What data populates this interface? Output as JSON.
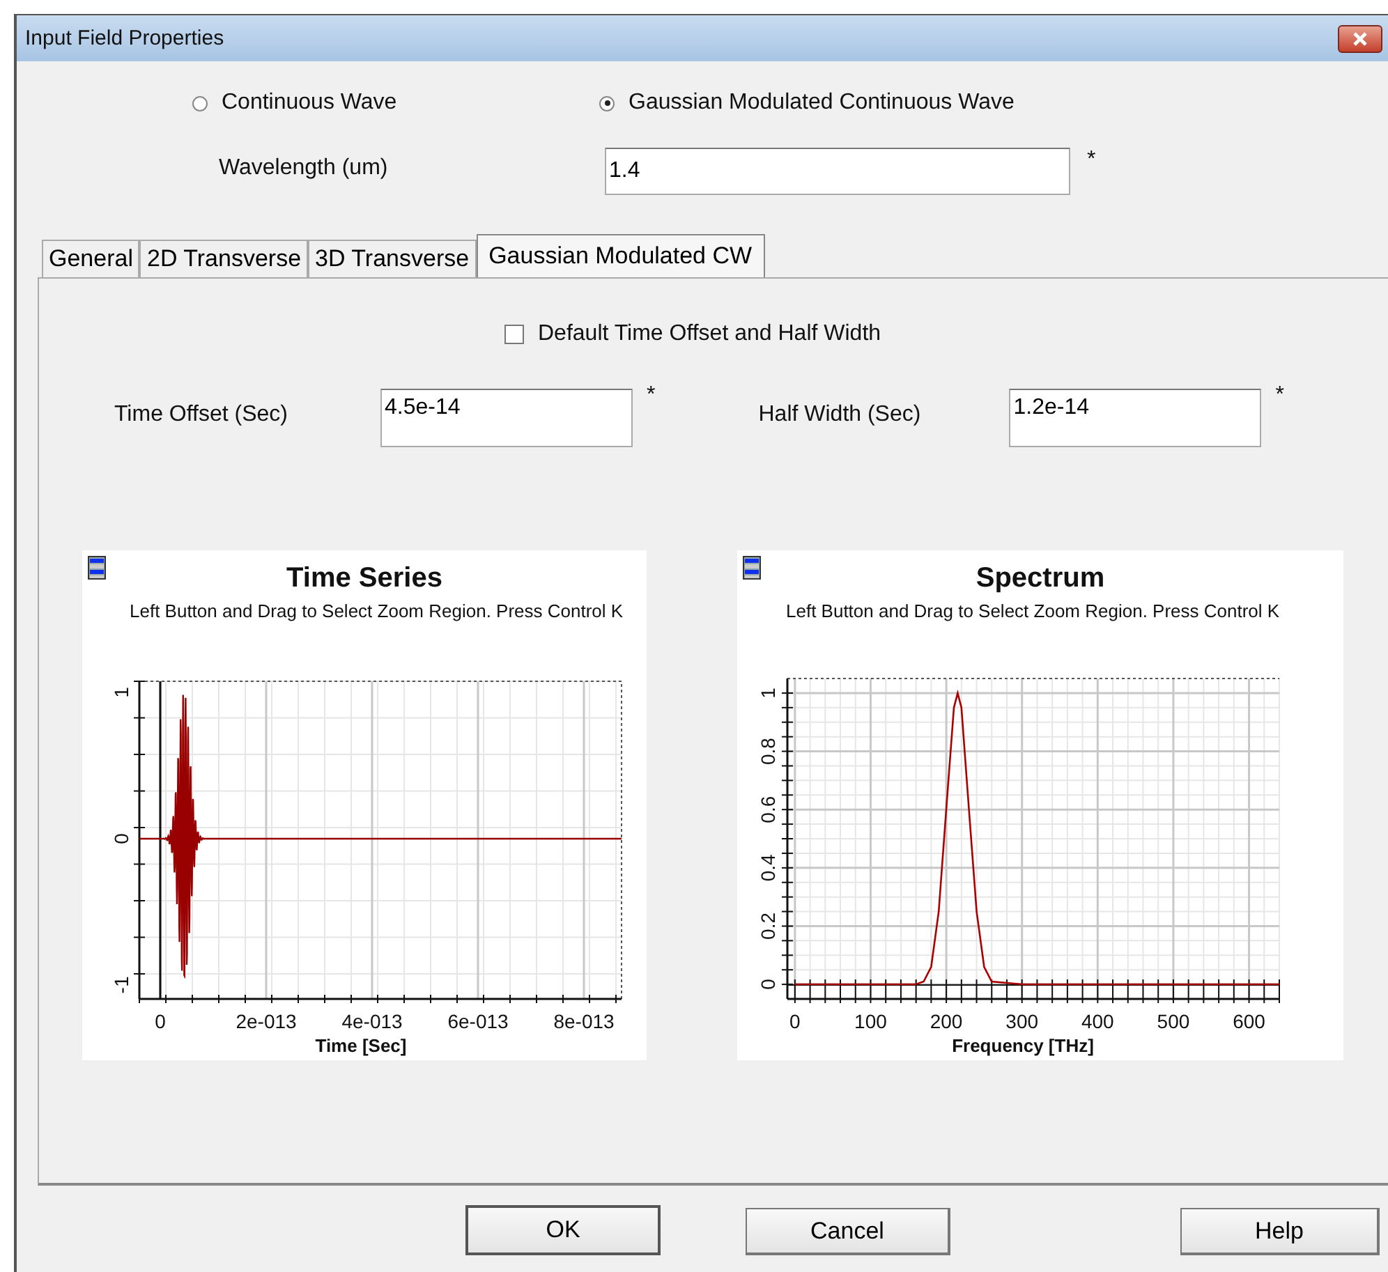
{
  "window": {
    "title": "Input Field Properties"
  },
  "wave_type": [
    {
      "label": "Continuous Wave",
      "selected": false
    },
    {
      "label": "Gaussian Modulated Continuous Wave",
      "selected": true
    }
  ],
  "wavelength": {
    "label": "Wavelength (um)",
    "value": "1.4",
    "required_mark": "*"
  },
  "tabs": [
    {
      "label": "General",
      "selected": false
    },
    {
      "label": "2D Transverse",
      "selected": false
    },
    {
      "label": "3D Transverse",
      "selected": false
    },
    {
      "label": "Gaussian Modulated CW",
      "selected": true
    }
  ],
  "default_checkbox": {
    "label": "Default Time Offset and Half Width",
    "checked": false
  },
  "fields": [
    {
      "label": "Time Offset (Sec)",
      "value": "4.5e-14",
      "required_mark": "*"
    },
    {
      "label": "Half Width (Sec)",
      "value": "1.2e-14",
      "required_mark": "*"
    }
  ],
  "time_series": {
    "title": "Time Series",
    "hint": "Left Button and Drag to Select Zoom Region. Press Control K",
    "xlabel": "Time [Sec]",
    "xticks": [
      "0",
      "2e-013",
      "4e-013",
      "6e-013",
      "8e-013"
    ],
    "yticks": [
      "1",
      "0",
      "-1"
    ]
  },
  "spectrum": {
    "hint": "Left Button and Drag to Select Zoom Region. Press Control K",
    "chart_data": {
      "type": "line",
      "title": "Spectrum",
      "xlabel": "Frequency [THz]",
      "x": [
        0,
        100,
        160,
        170,
        180,
        190,
        200,
        210,
        215,
        220,
        230,
        240,
        250,
        260,
        300,
        400,
        500,
        600,
        640
      ],
      "series": [
        {
          "color": "#aa0000",
          "values": [
            0,
            0,
            0,
            0.01,
            0.06,
            0.25,
            0.6,
            0.95,
            1,
            0.95,
            0.6,
            0.25,
            0.06,
            0.01,
            0,
            0,
            0,
            0,
            0
          ]
        }
      ],
      "xlim": [
        -10,
        640
      ],
      "ylim": [
        -0.05,
        1.05
      ],
      "grid": true,
      "xticks": [
        0,
        100,
        200,
        300,
        400,
        500,
        600
      ],
      "yticks": [
        0,
        0.2,
        0.4,
        0.6,
        0.8,
        1
      ]
    }
  },
  "buttons": [
    {
      "label": "OK",
      "default": true
    },
    {
      "label": "Cancel",
      "default": false
    },
    {
      "label": "Help",
      "default": false
    }
  ]
}
